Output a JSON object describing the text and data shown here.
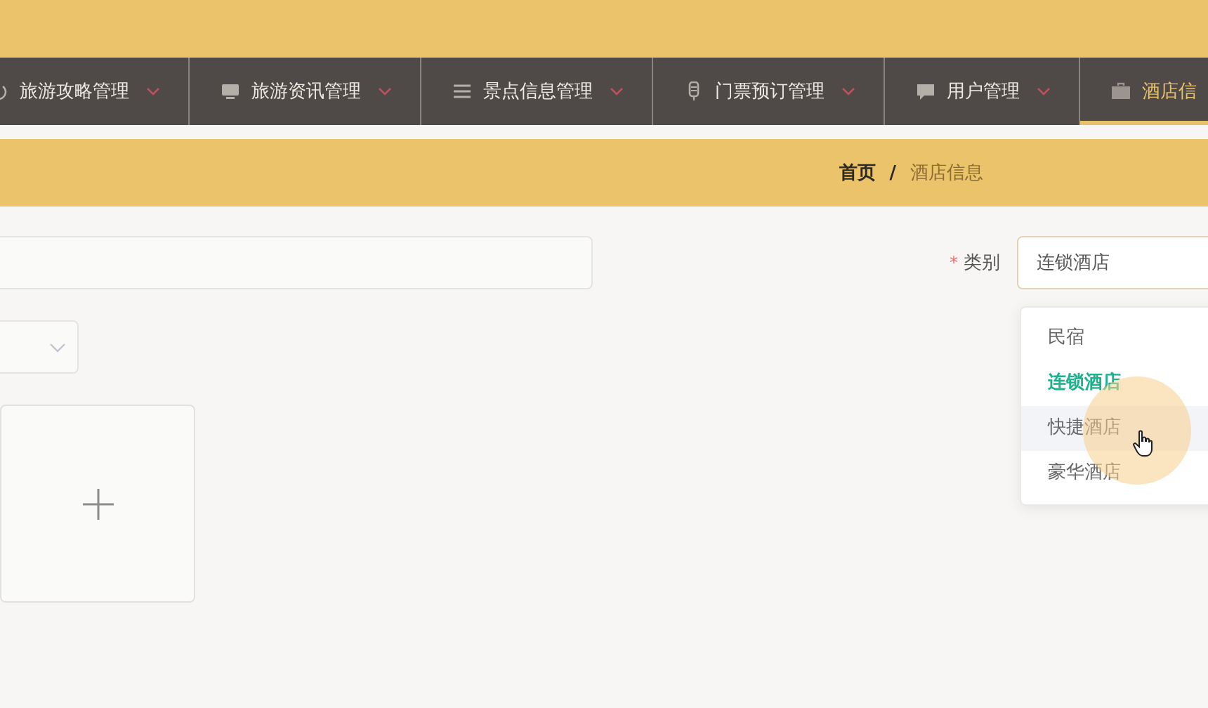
{
  "nav": {
    "items": [
      {
        "label": "旅游攻略管理",
        "selected": false
      },
      {
        "label": "旅游资讯管理",
        "selected": false
      },
      {
        "label": "景点信息管理",
        "selected": false
      },
      {
        "label": "门票预订管理",
        "selected": false
      },
      {
        "label": "用户管理",
        "selected": false
      },
      {
        "label": "酒店信",
        "selected": true
      }
    ]
  },
  "breadcrumb": {
    "separator": "/",
    "items": [
      {
        "label": "首页",
        "current": false
      },
      {
        "label": "酒店信息",
        "current": true
      }
    ]
  },
  "category": {
    "required_mark": "*",
    "label": "类别",
    "value": "连锁酒店",
    "expanded": true,
    "options": [
      {
        "label": "民宿",
        "selected": false,
        "hovered": false
      },
      {
        "label": "连锁酒店",
        "selected": true,
        "hovered": false
      },
      {
        "label": "快捷酒店",
        "selected": false,
        "hovered": true
      },
      {
        "label": "豪华酒店",
        "selected": false,
        "hovered": false
      }
    ]
  },
  "cursor": {
    "highlighted": true
  }
}
